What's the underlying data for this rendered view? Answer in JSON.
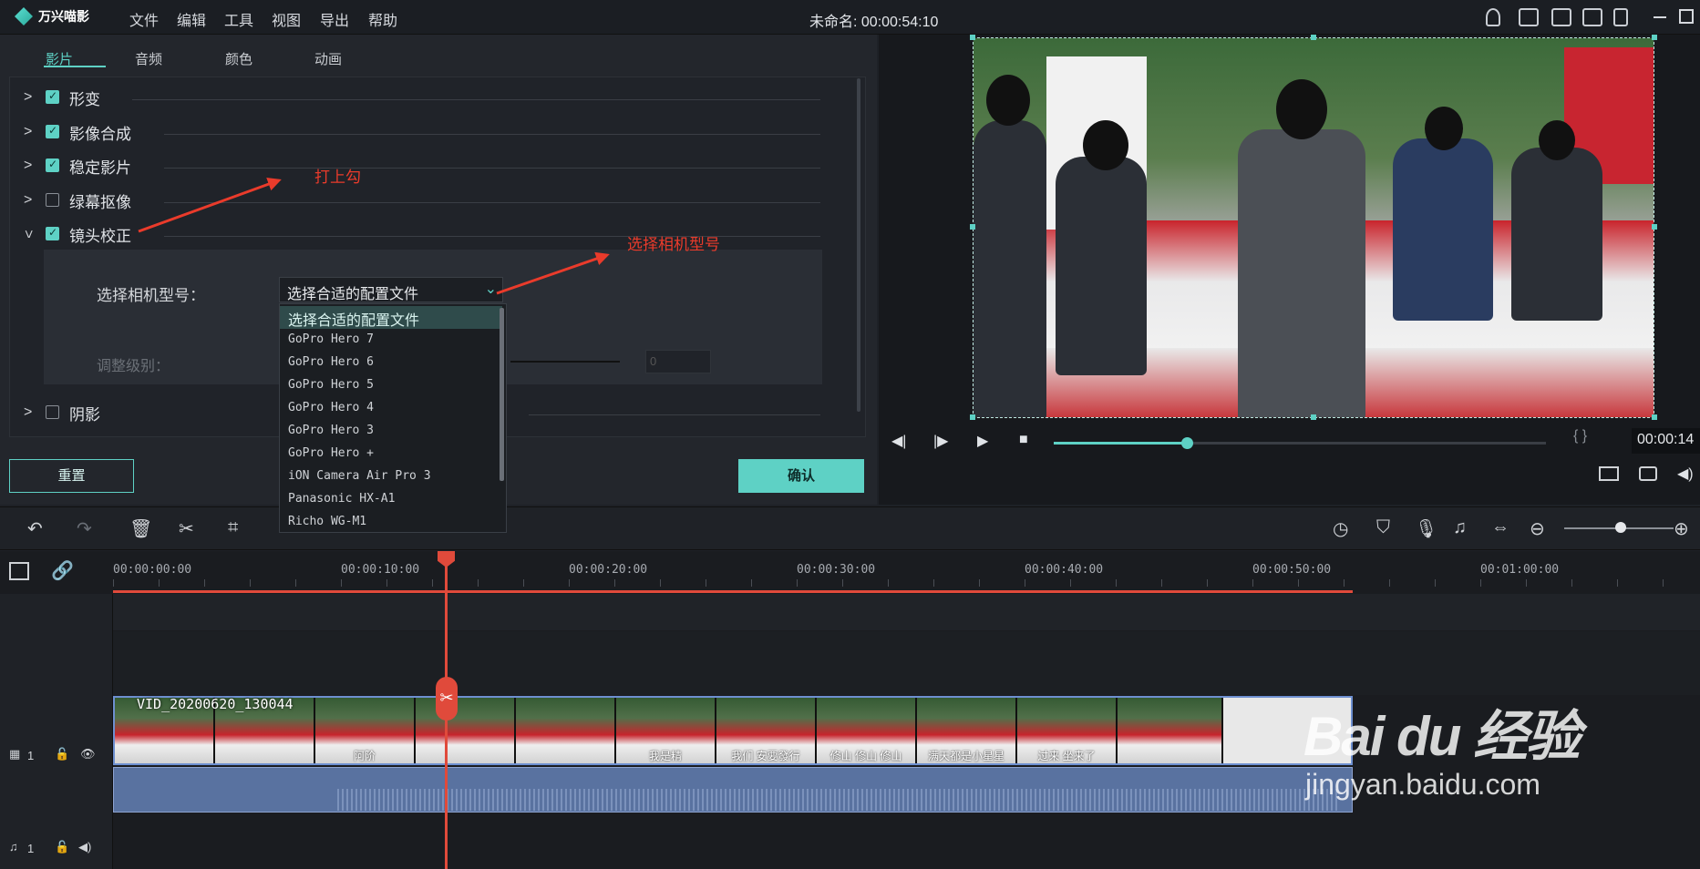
{
  "app": {
    "name": "万兴喵影",
    "menu": [
      "文件",
      "编辑",
      "工具",
      "视图",
      "导出",
      "帮助"
    ],
    "doc_title": "未命名: 00:00:54:10"
  },
  "tabs": [
    "影片",
    "音频",
    "颜色",
    "动画"
  ],
  "properties": [
    {
      "label": "形变",
      "checked": true
    },
    {
      "label": "影像合成",
      "checked": true
    },
    {
      "label": "稳定影片",
      "checked": true
    },
    {
      "label": "绿幕抠像",
      "checked": false
    },
    {
      "label": "镜头校正",
      "checked": true
    },
    {
      "label": "阴影",
      "checked": false
    }
  ],
  "lens": {
    "camera_label": "选择相机型号：",
    "select_value": "选择合适的配置文件",
    "adjust_label": "调整级别：",
    "adjust_value": "0",
    "options": [
      "选择合适的配置文件",
      "GoPro Hero 7",
      "GoPro Hero 6",
      "GoPro Hero 5",
      "GoPro Hero 4",
      "GoPro Hero 3",
      "GoPro Hero +",
      "iON Camera Air Pro 3",
      "Panasonic HX-A1",
      "Richo WG-M1"
    ]
  },
  "buttons": {
    "reset": "重置",
    "confirm": "确认"
  },
  "annotations": {
    "check": "打上勾",
    "select_camera": "选择相机型号"
  },
  "player": {
    "timecode": "00:00:14",
    "progress": 0.27
  },
  "timeline": {
    "ticks": [
      "00:00:00:00",
      "00:00:10:00",
      "00:00:20:00",
      "00:00:30:00",
      "00:00:40:00",
      "00:00:50:00",
      "00:01:00:00"
    ],
    "clip_name": "VID_20200620_130044",
    "captions": [
      "",
      "",
      "阿阶",
      "",
      "",
      "我是精",
      "我们    安要發行",
      "修山   修山   修山",
      "满天都是小星星",
      "过来   坐来了",
      ""
    ],
    "video_track": "1",
    "audio_track": "1"
  },
  "watermark": {
    "logo": "Bai du 经验",
    "url": "jingyan.baidu.com"
  },
  "colors": {
    "accent": "#5ed1c5",
    "playhead": "#e04a3b",
    "annotation": "#ea3b2b"
  }
}
